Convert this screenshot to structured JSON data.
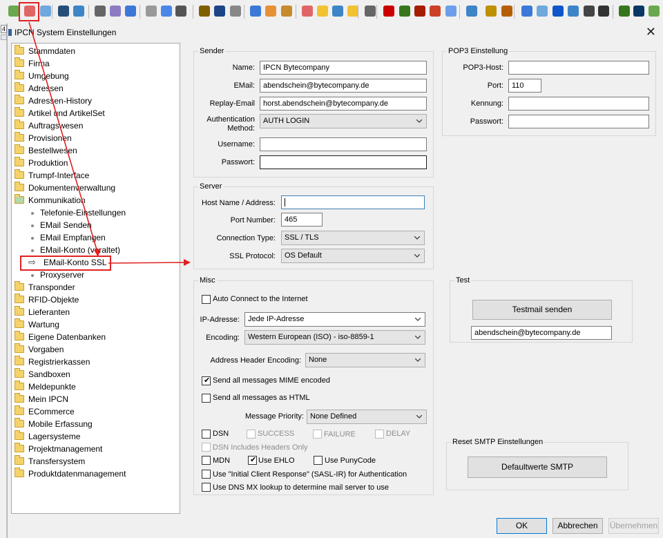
{
  "toolbar": {
    "icons": [
      "settings-icon",
      "settings-gear-icon",
      "settings-blue-icon",
      "user-icon",
      "user-check-icon",
      "printer-icon",
      "cabinet-icon",
      "report-icon",
      "clock-icon",
      "globe-icon",
      "phone-icon",
      "users-group-icon",
      "edit-icon",
      "wheel-icon",
      "gears-icon",
      "box-icon",
      "package-icon",
      "people-icon",
      "sync-icon",
      "cart-icon",
      "star-icon",
      "calculator-icon",
      "book-icon",
      "green-book-icon",
      "red-book-icon",
      "eraser-icon",
      "chart-icon",
      "pie-chart-icon",
      "yellow-book-icon",
      "brown-book-icon",
      "export-icon",
      "chat-icon",
      "euro-icon",
      "message-icon",
      "card-icon",
      "mobile-icon",
      "download-icon",
      "person-icon",
      "person-gear-icon"
    ]
  },
  "dialog": {
    "title": "IPCN System Einstellungen",
    "close_symbol": "✕"
  },
  "tree": {
    "items": [
      {
        "label": "Stammdaten",
        "kind": "folder"
      },
      {
        "label": "Firma",
        "kind": "folder"
      },
      {
        "label": "Umgebung",
        "kind": "folder"
      },
      {
        "label": "Adressen",
        "kind": "folder"
      },
      {
        "label": "Adressen-History",
        "kind": "folder"
      },
      {
        "label": "Artikel und ArtikelSet",
        "kind": "folder"
      },
      {
        "label": "Auftragswesen",
        "kind": "folder"
      },
      {
        "label": "Provisionen",
        "kind": "folder"
      },
      {
        "label": "Bestellwesen",
        "kind": "folder"
      },
      {
        "label": "Produktion",
        "kind": "folder"
      },
      {
        "label": "Trumpf-Interface",
        "kind": "folder"
      },
      {
        "label": "Dokumentenverwaltung",
        "kind": "folder"
      },
      {
        "label": "Kommunikation",
        "kind": "folder-open"
      },
      {
        "label": "Telefonie-Einstellungen",
        "kind": "child"
      },
      {
        "label": "EMail Senden",
        "kind": "child"
      },
      {
        "label": "EMail Empfangen",
        "kind": "child"
      },
      {
        "label": "EMail-Konto (veraltet)",
        "kind": "child"
      },
      {
        "label": "EMail-Konto SSL",
        "kind": "child-selected"
      },
      {
        "label": "Proxyserver",
        "kind": "child"
      },
      {
        "label": "Transponder",
        "kind": "folder"
      },
      {
        "label": "RFID-Objekte",
        "kind": "folder"
      },
      {
        "label": "Lieferanten",
        "kind": "folder"
      },
      {
        "label": "Wartung",
        "kind": "folder"
      },
      {
        "label": "Eigene Datenbanken",
        "kind": "folder"
      },
      {
        "label": "Vorgaben",
        "kind": "folder"
      },
      {
        "label": "Registrierkassen",
        "kind": "folder"
      },
      {
        "label": "Sandboxen",
        "kind": "folder"
      },
      {
        "label": "Meldepunkte",
        "kind": "folder"
      },
      {
        "label": "Mein IPCN",
        "kind": "folder"
      },
      {
        "label": "ECommerce",
        "kind": "folder"
      },
      {
        "label": "Mobile Erfassung",
        "kind": "folder"
      },
      {
        "label": "Lagersysteme",
        "kind": "folder"
      },
      {
        "label": "Projektmanagement",
        "kind": "folder"
      },
      {
        "label": "Transfersystem",
        "kind": "folder"
      },
      {
        "label": "Produktdatenmanagement",
        "kind": "folder"
      }
    ]
  },
  "sender": {
    "title": "Sender",
    "name_label": "Name:",
    "name_value": "IPCN Bytecompany",
    "email_label": "EMail:",
    "email_value": "abendschein@bytecompany.de",
    "reply_label": "Replay-Email",
    "reply_value": "horst.abendschein@bytecompany.de",
    "auth_label_1": "Authentication",
    "auth_label_2": "Method:",
    "auth_value": "AUTH LOGIN",
    "username_label": "Username:",
    "username_value": "",
    "password_label": "Passwort:",
    "password_value": ""
  },
  "pop3": {
    "title": "POP3 Einstellung",
    "host_label": "POP3-Host:",
    "host_value": "",
    "port_label": "Port:",
    "port_value": "110",
    "kennung_label": "Kennung:",
    "kennung_value": "",
    "password_label": "Passwort:",
    "password_value": ""
  },
  "server": {
    "title": "Server",
    "host_label": "Host Name / Address:",
    "host_value": "",
    "port_label": "Port Number:",
    "port_value": "465",
    "conn_label": "Connection Type:",
    "conn_value": "SSL / TLS",
    "ssl_label": "SSL Protocol:",
    "ssl_value": "OS Default"
  },
  "misc": {
    "title": "Misc",
    "auto_connect": "Auto Connect to the Internet",
    "ip_label": "IP-Adresse:",
    "ip_value": "Jede IP-Adresse",
    "enc_label": "Encoding:",
    "enc_value": "Western European (ISO) - iso-8859-1",
    "addr_label": "Address Header Encoding:",
    "addr_value": "None",
    "mime_label": "Send all messages MIME encoded",
    "html_label": "Send all messages as HTML",
    "prio_label": "Message Priority:",
    "prio_value": "None Defined",
    "dsn": "DSN",
    "success": "SUCCESS",
    "failure": "FAILURE",
    "delay": "DELAY",
    "dsn_headers": "DSN Includes Headers Only",
    "mdn": "MDN",
    "ehlo": "Use EHLO",
    "puny": "Use PunyCode",
    "sasl": "Use \"Initial Client Response\" (SASL-IR) for Authentication",
    "dns": "Use DNS MX lookup to determine mail server to use"
  },
  "test": {
    "title": "Test",
    "button": "Testmail senden",
    "email_value": "abendschein@bytecompany.de"
  },
  "reset": {
    "title": "Reset SMTP Einstellungen",
    "button": "Defaultwerte SMTP"
  },
  "footer": {
    "ok": "OK",
    "cancel": "Abbrechen",
    "apply": "Übernehmen"
  },
  "colors": {
    "highlight_red": "#e02020",
    "focus_blue": "#3c7fb1",
    "default_button_blue": "#0078d7"
  }
}
